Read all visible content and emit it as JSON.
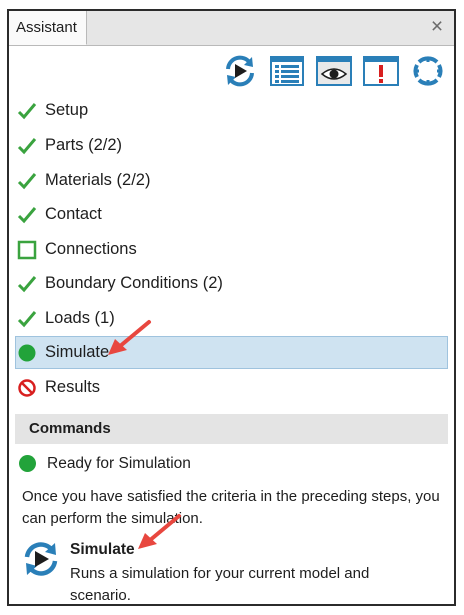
{
  "panel": {
    "tab_title": "Assistant",
    "close_glyph": "×"
  },
  "toolbar": {
    "buttons": [
      {
        "icon": "simulate-refresh-icon"
      },
      {
        "icon": "list-view-icon"
      },
      {
        "icon": "eye-icon"
      },
      {
        "icon": "alert-icon"
      },
      {
        "icon": "reset-icon"
      }
    ]
  },
  "steps": [
    {
      "label": "Setup",
      "status": "complete"
    },
    {
      "label": "Parts (2/2)",
      "status": "complete"
    },
    {
      "label": "Materials (2/2)",
      "status": "complete"
    },
    {
      "label": "Contact",
      "status": "complete"
    },
    {
      "label": "Connections",
      "status": "incomplete"
    },
    {
      "label": "Boundary Conditions (2)",
      "status": "complete"
    },
    {
      "label": "Loads (1)",
      "status": "complete"
    },
    {
      "label": "Simulate",
      "status": "ready",
      "selected": true
    },
    {
      "label": "Results",
      "status": "unavailable"
    }
  ],
  "commands": {
    "header": "Commands",
    "status_text": "Ready for Simulation",
    "description": "Once you have satisfied the criteria in the preceding steps, you can perform the simulation.",
    "item_title": "Simulate",
    "item_description": "Runs a simulation for your current model and scenario."
  },
  "colors": {
    "check": "#3aa33f",
    "ready": "#22a33a",
    "unavailable": "#d81f1f",
    "selection": "#cfe3f1",
    "annotation_arrow": "#e8473f"
  }
}
